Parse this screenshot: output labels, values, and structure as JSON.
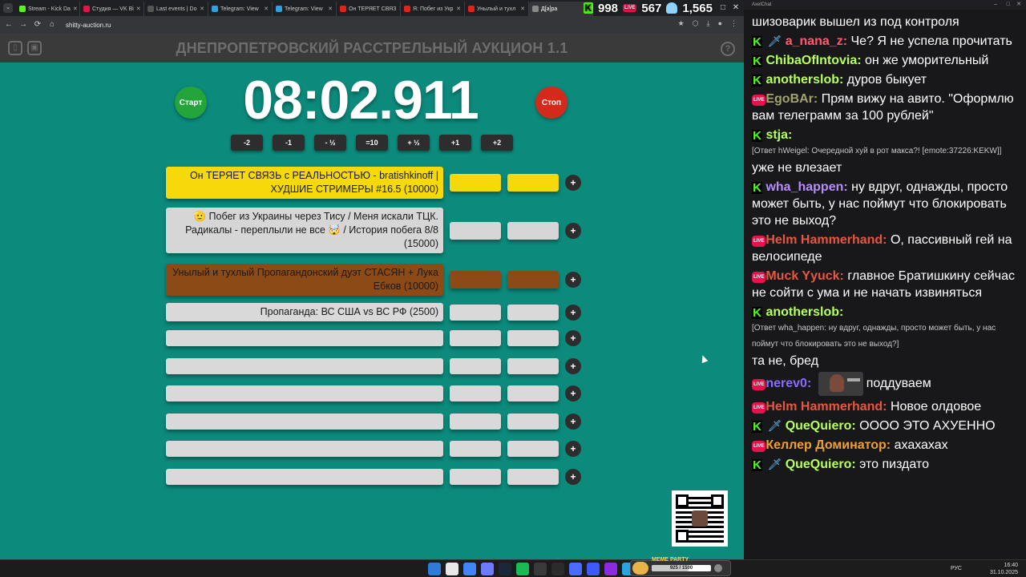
{
  "browser": {
    "tabs": [
      {
        "label": "Stream - Kick Da",
        "color": "#53fc18"
      },
      {
        "label": "Студия — VK Bi",
        "color": "#e9114c"
      },
      {
        "label": "Last events | Do",
        "color": "#555555"
      },
      {
        "label": "Telegram: View",
        "color": "#2aa3de"
      },
      {
        "label": "Telegram: View",
        "color": "#2aa3de"
      },
      {
        "label": "Он ТЕРЯЕТ СВЯЗ",
        "color": "#e62117"
      },
      {
        "label": "Я: Побег из Укр",
        "color": "#e62117"
      },
      {
        "label": "Унылый и тухл",
        "color": "#e62117"
      },
      {
        "label": "Д[а]ра",
        "color": "#888888"
      }
    ],
    "url": "shitty-auction.ru"
  },
  "overlay_stats": {
    "kick_count": "998",
    "vk_count": "567",
    "viewers": "1,565",
    "live_label": "LIVE"
  },
  "auction": {
    "title": "ДНЕПРОПЕТРОВСКИЙ РАССТРЕЛЬНЫЙ АУКЦИОН 1.1",
    "help_label": "?",
    "start_label": "Старт",
    "stop_label": "Стоп",
    "timer": "08:02.911",
    "time_buttons": [
      "-2",
      "-1",
      "- ½",
      "=10",
      "+ ½",
      "+1",
      "+2"
    ],
    "plus_label": "+",
    "lots": [
      {
        "text": "Он ТЕРЯЕТ СВЯЗЬ с РЕАЛЬНОСТЬЮ - bratishkinoff | ХУДШИЕ СТРИМЕРЫ #16.5 (10000)",
        "color": "yellow"
      },
      {
        "text": "🫡 Побег из Украины через Тису / Меня искали ТЦК. Радикалы - переплыли не все 🤯 / История побега 8/8 (15000)",
        "color": "gray"
      },
      {
        "text": "Унылый и тухлый Пропагандонский дуэт СТАСЯН + Лука Ебков (10000)",
        "color": "brown"
      },
      {
        "text": "Пропаганда: ВС США vs ВС РФ (2500)",
        "color": "empty"
      },
      {
        "text": "",
        "color": "empty"
      },
      {
        "text": "",
        "color": "empty"
      },
      {
        "text": "",
        "color": "empty"
      },
      {
        "text": "",
        "color": "empty"
      },
      {
        "text": "",
        "color": "empty"
      },
      {
        "text": "",
        "color": "empty"
      }
    ]
  },
  "meme_party": {
    "title": "MEME PARTY",
    "progress": "925 / 1500",
    "fraction": 0.617
  },
  "taskbar": {
    "lang": "РУС",
    "time": "16:40",
    "date": "31.10.2025"
  },
  "chat": {
    "window_title": "AxelChat",
    "messages": [
      {
        "platform": "",
        "nick": "",
        "color": "#ffffff",
        "text": "шизоварик вышел из под контроля"
      },
      {
        "platform": "kick",
        "sword": true,
        "nick": "a_nana_z:",
        "color": "#ff5a6e",
        "text": "Че? Я не успела прочитать"
      },
      {
        "platform": "kick",
        "nick": "ChibaOfIntovia:",
        "color": "#b7ff5c",
        "text": "он же уморительный"
      },
      {
        "platform": "kick",
        "nick": "anotherslob:",
        "color": "#b7ff5c",
        "text": "дуров быкует"
      },
      {
        "platform": "vk",
        "nick": "EgoBAr:",
        "color": "#a3a36a",
        "text": "Прям вижу на авито. \"Оформлю вам телеграмм за 100 рублей\""
      },
      {
        "platform": "kick",
        "nick": "stja:",
        "color": "#b7ff5c",
        "reply": "[Ответ hWeigel: Очередной хуй в рот макса?! [emote:37226:KEKW]]",
        "text": "уже не влезает"
      },
      {
        "platform": "kick",
        "nick": "wha_happen:",
        "color": "#b88bff",
        "text": "ну вдруг, однажды, просто может быть, у нас поймут что блокировать это не выход?"
      },
      {
        "platform": "vk",
        "nick": "Helm Hammerhand:",
        "color": "#e8573d",
        "text": "О, пассивный гей на велосипеде"
      },
      {
        "platform": "vk",
        "nick": "Muck Yyuck:",
        "color": "#e8573d",
        "text": "главное Братишкину сейчас не сойти с ума и не начать извиняться"
      },
      {
        "platform": "kick",
        "nick": "anotherslob:",
        "color": "#b7ff5c",
        "reply": "[Ответ wha_happen: ну вдруг, однажды, просто может быть, у нас поймут что блокировать это не выход?]",
        "text": "та не, бред"
      },
      {
        "platform": "vk",
        "nick": "nerev0:",
        "color": "#8a6cff",
        "emote": true,
        "text": "поддуваем"
      },
      {
        "platform": "vk",
        "nick": "Helm Hammerhand:",
        "color": "#e8573d",
        "text": "Новое олдовое"
      },
      {
        "platform": "kick",
        "sword": true,
        "nick": "QueQuiero:",
        "color": "#b7ff5c",
        "text": "ОООО ЭТО АХУЕННО"
      },
      {
        "platform": "vk",
        "nick": "Келлер Доминатор:",
        "color": "#f0a030",
        "text": "ахахахах"
      },
      {
        "platform": "kick",
        "sword": true,
        "nick": "QueQuiero:",
        "color": "#b7ff5c",
        "text": "это пиздато"
      }
    ]
  },
  "icons": [
    "sidebar-toggle-icon",
    "save-icon",
    "help-icon",
    "back-arrow-icon",
    "forward-arrow-icon",
    "reload-icon",
    "home-icon",
    "star-icon",
    "kick-logo-icon",
    "live-icon",
    "viewer-icon",
    "sword-icon",
    "qr-code-icon",
    "cursor-icon",
    "windows-start-icon"
  ],
  "colors": {
    "page_bg": "#0c8a7c",
    "header_bg": "#3a3a3a",
    "start": "#24a53c",
    "stop": "#d42a1b",
    "lot_yellow": "#f5d90a",
    "lot_brown": "#8b4a16",
    "lot_gray": "#d6d6d6",
    "chat_bg": "#18181b",
    "kick_green": "#53fc18",
    "vk_live_red": "#e9114c"
  }
}
